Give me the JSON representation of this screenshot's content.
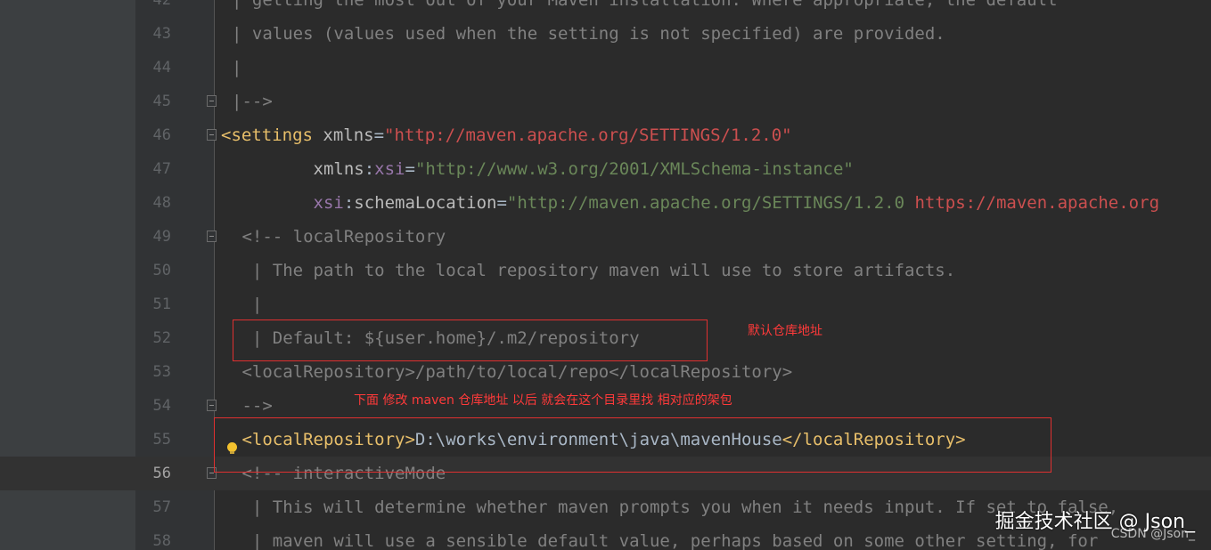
{
  "lines": [
    {
      "num": "42",
      "parts": [
        [
          "comment",
          "| getting the most out of your Maven installation. Where appropriate, the default"
        ]
      ]
    },
    {
      "num": "43",
      "parts": [
        [
          "comment",
          "| values (values used when the setting is not specified) are provided."
        ]
      ]
    },
    {
      "num": "44",
      "parts": [
        [
          "comment",
          "|"
        ]
      ]
    },
    {
      "num": "45",
      "parts": [
        [
          "comment",
          "|-->"
        ]
      ]
    },
    {
      "num": "46",
      "parts": [
        [
          "tag",
          "<settings "
        ],
        [
          "attr",
          "xmlns"
        ],
        [
          "text",
          "="
        ],
        [
          "url-red",
          "\"http://maven.apache.org/SETTINGS/1.2.0\""
        ]
      ]
    },
    {
      "num": "47",
      "parts": [
        [
          "attr",
          "        xmlns"
        ],
        [
          "text",
          ":"
        ],
        [
          "ns",
          "xsi"
        ],
        [
          "text",
          "="
        ],
        [
          "str",
          "\"http://www.w3.org/2001/XMLSchema-instance\""
        ]
      ]
    },
    {
      "num": "48",
      "parts": [
        [
          "ns",
          "        xsi"
        ],
        [
          "text",
          ":"
        ],
        [
          "attr",
          "schemaLocation"
        ],
        [
          "text",
          "="
        ],
        [
          "str",
          "\"http://maven.apache.org/SETTINGS/1.2.0 "
        ],
        [
          "url-red",
          "https://maven.apache.org"
        ]
      ]
    },
    {
      "num": "49",
      "parts": [
        [
          "comment",
          " <!-- localRepository"
        ]
      ]
    },
    {
      "num": "50",
      "parts": [
        [
          "comment",
          "  | The path to the local repository maven will use to store artifacts."
        ]
      ]
    },
    {
      "num": "51",
      "parts": [
        [
          "comment",
          "  |"
        ]
      ]
    },
    {
      "num": "52",
      "parts": [
        [
          "comment",
          "  | Default: ${user.home}/.m2/repository"
        ]
      ]
    },
    {
      "num": "53",
      "parts": [
        [
          "comment",
          " <localRepository>/path/to/local/repo</localRepository>"
        ]
      ]
    },
    {
      "num": "54",
      "parts": [
        [
          "comment",
          " -->"
        ]
      ]
    },
    {
      "num": "55",
      "parts": [
        [
          "tag",
          " <localRepository>"
        ],
        [
          "text",
          "D:\\works\\environment\\java\\mavenHouse"
        ],
        [
          "tag",
          "</localRepository>"
        ]
      ]
    },
    {
      "num": "56",
      "parts": [
        [
          "comment",
          " <!-- interactiveMode"
        ]
      ]
    },
    {
      "num": "57",
      "parts": [
        [
          "comment",
          "  | This will determine whether maven prompts you when it needs input. If set to false,"
        ]
      ]
    },
    {
      "num": "58",
      "parts": [
        [
          "comment",
          "  | maven will use a sensible default value, perhaps based on some other setting, for"
        ]
      ]
    }
  ],
  "annotations": {
    "default_repo_note": "默认仓库地址",
    "modified_repo_note": "下面 修改 maven 仓库地址  以后 就会在这个目录里找 相对应的架包"
  },
  "watermark": {
    "main": "掘金技术社区 @ Json_",
    "sub": "CSDN @Json_"
  }
}
